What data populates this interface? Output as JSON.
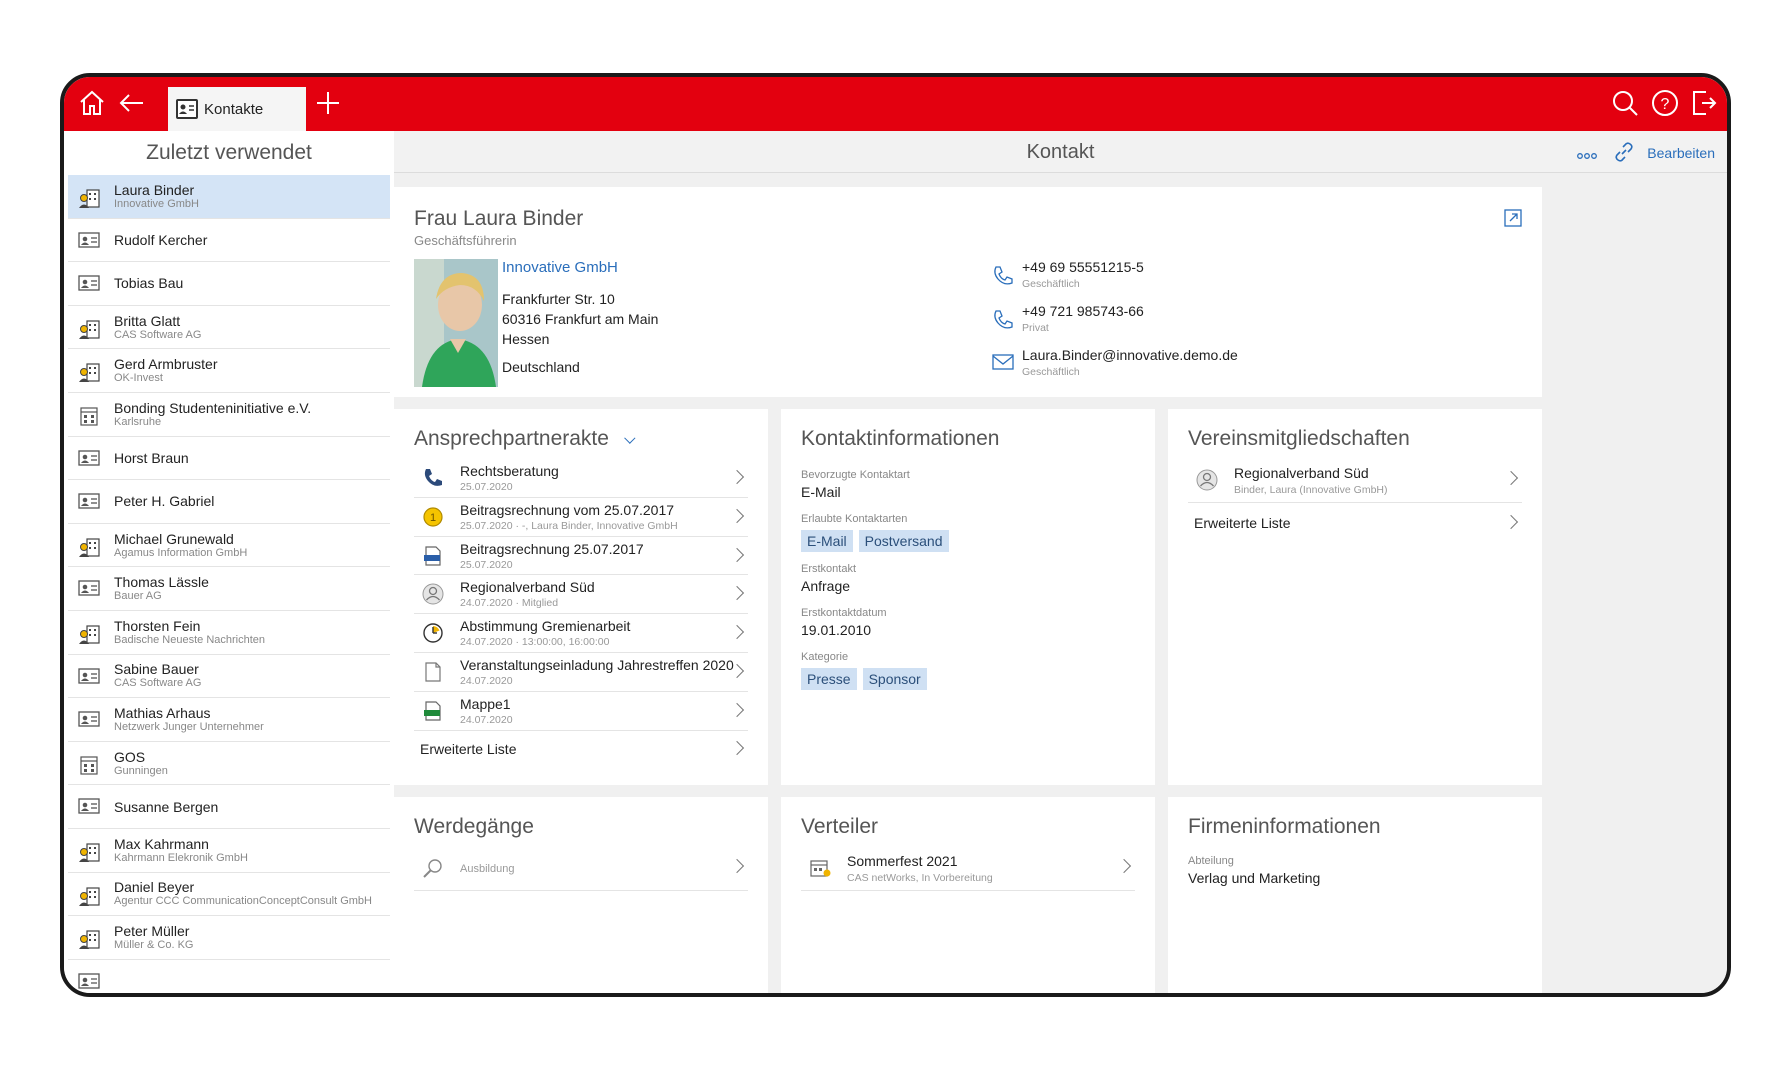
{
  "topbar": {
    "tab_label": "Kontakte"
  },
  "sidebar": {
    "title": "Zuletzt verwendet",
    "items": [
      {
        "name": "Laura Binder",
        "sub": "Innovative GmbH",
        "icon": "person-company-icon",
        "active": true
      },
      {
        "name": "Rudolf Kercher",
        "sub": "",
        "icon": "contact-card-icon"
      },
      {
        "name": "Tobias Bau",
        "sub": "",
        "icon": "contact-card-icon"
      },
      {
        "name": "Britta Glatt",
        "sub": "CAS Software AG",
        "icon": "person-company-icon"
      },
      {
        "name": "Gerd Armbruster",
        "sub": "OK-Invest",
        "icon": "person-company-icon"
      },
      {
        "name": "Bonding Studenteninitiative e.V.",
        "sub": "Karlsruhe",
        "icon": "company-icon"
      },
      {
        "name": "Horst Braun",
        "sub": "",
        "icon": "contact-card-icon"
      },
      {
        "name": "Peter H. Gabriel",
        "sub": "",
        "icon": "contact-card-icon"
      },
      {
        "name": "Michael Grunewald",
        "sub": "Agamus Information GmbH",
        "icon": "person-company-icon"
      },
      {
        "name": "Thomas Lässle",
        "sub": "Bauer AG",
        "icon": "contact-card-icon"
      },
      {
        "name": "Thorsten Fein",
        "sub": "Badische Neueste Nachrichten",
        "icon": "person-company-icon"
      },
      {
        "name": "Sabine Bauer",
        "sub": "CAS Software AG",
        "icon": "contact-card-icon"
      },
      {
        "name": "Mathias Arhaus",
        "sub": "Netzwerk Junger Unternehmer",
        "icon": "contact-card-icon"
      },
      {
        "name": "GOS",
        "sub": "Gunningen",
        "icon": "company-icon"
      },
      {
        "name": "Susanne Bergen",
        "sub": "",
        "icon": "contact-card-icon"
      },
      {
        "name": "Max Kahrmann",
        "sub": "Kahrmann Elekronik GmbH",
        "icon": "person-company-icon"
      },
      {
        "name": "Daniel Beyer",
        "sub": "Agentur CCC CommunicationConceptConsult GmbH",
        "icon": "person-company-icon"
      },
      {
        "name": "Peter Müller",
        "sub": "Müller & Co. KG",
        "icon": "person-company-icon"
      },
      {
        "name": "",
        "sub": "",
        "icon": "contact-card-icon"
      }
    ]
  },
  "main": {
    "title": "Kontakt",
    "edit_label": "Bearbeiten",
    "contact": {
      "name": "Frau Laura Binder",
      "role": "Geschäftsführerin",
      "company": "Innovative GmbH",
      "street": "Frankfurter Str. 10",
      "city": "60316 Frankfurt am Main",
      "state": "Hessen",
      "country": "Deutschland",
      "phone1": "+49 69 55551215-5",
      "phone1_label": "Geschäftlich",
      "phone2": "+49 721 985743-66",
      "phone2_label": "Privat",
      "email": "Laura.Binder@innovative.demo.de",
      "email_label": "Geschäftlich"
    },
    "ansprech": {
      "title": "Ansprechpartnerakte",
      "rows": [
        {
          "title": "Rechtsberatung",
          "sub": "25.07.2020",
          "icon": "phone-icon"
        },
        {
          "title": "Beitragsrechnung vom 25.07.2017",
          "sub": "25.07.2020 · -, Laura Binder, Innovative GmbH",
          "icon": "coin-icon"
        },
        {
          "title": "Beitragsrechnung 25.07.2017",
          "sub": "25.07.2020",
          "icon": "doc-file-icon"
        },
        {
          "title": "Regionalverband Süd",
          "sub": "24.07.2020 · Mitglied",
          "icon": "member-icon"
        },
        {
          "title": "Abstimmung Gremienarbeit",
          "sub": "24.07.2020 · 13:00:00, 16:00:00",
          "icon": "clock-icon"
        },
        {
          "title": "Veranstaltungseinladung Jahrestreffen 2020",
          "sub": "24.07.2020",
          "icon": "document-icon"
        },
        {
          "title": "Mappe1",
          "sub": "24.07.2020",
          "icon": "xls-file-icon"
        }
      ],
      "more": "Erweiterte Liste"
    },
    "kontaktinfo": {
      "title": "Kontaktinformationen",
      "pref_label": "Bevorzugte Kontaktart",
      "pref_value": "E-Mail",
      "allowed_label": "Erlaubte Kontaktarten",
      "allowed": [
        "E-Mail",
        "Postversand"
      ],
      "first_label": "Erstkontakt",
      "first_value": "Anfrage",
      "firstdate_label": "Erstkontaktdatum",
      "firstdate_value": "19.01.2010",
      "cat_label": "Kategorie",
      "categories": [
        "Presse",
        "Sponsor"
      ]
    },
    "verein": {
      "title": "Vereinsmitgliedschaften",
      "row_title": "Regionalverband Süd",
      "row_sub": "Binder, Laura (Innovative GmbH)",
      "more": "Erweiterte Liste"
    },
    "werdegaenge": {
      "title": "Werdegänge",
      "row_title": "Ausbildung"
    },
    "verteiler": {
      "title": "Verteiler",
      "row_title": "Sommerfest 2021",
      "row_sub": "CAS netWorks, In Vorbereitung"
    },
    "firma": {
      "title": "Firmeninformationen",
      "label": "Abteilung",
      "value": "Verlag und Marketing"
    }
  },
  "colors": {
    "brand_red": "#e3000f",
    "link_blue": "#2a6ebb",
    "selected_bg": "#d4e4f6",
    "tag_bg": "#cfe0f3"
  }
}
